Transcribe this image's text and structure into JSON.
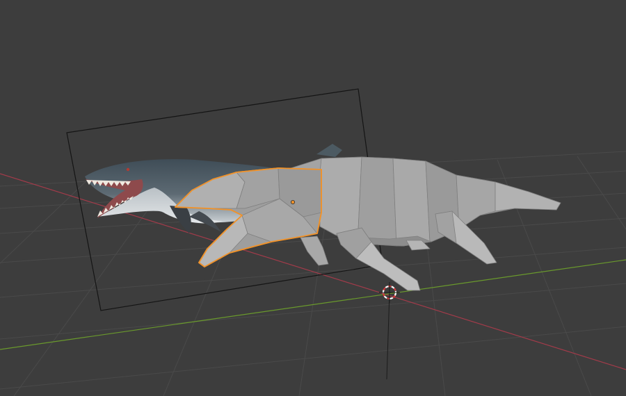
{
  "viewport": {
    "background": "#3d3d3d",
    "grid_color": "#4a4a4a",
    "x_axis_color": "#a33b4a",
    "y_axis_color": "#6a9a2c",
    "selection_color": "#f0922a",
    "mesh_color": "#9c9c9c"
  },
  "scene": {
    "objects": [
      {
        "name": "reference-image",
        "kind": "image-plane",
        "subject": "mosasaur"
      },
      {
        "name": "mosasaur-body",
        "kind": "low-poly-mesh",
        "selected": false
      },
      {
        "name": "mosasaur-head",
        "kind": "low-poly-mesh",
        "selected": true
      }
    ],
    "cursor": "3d-cursor"
  }
}
